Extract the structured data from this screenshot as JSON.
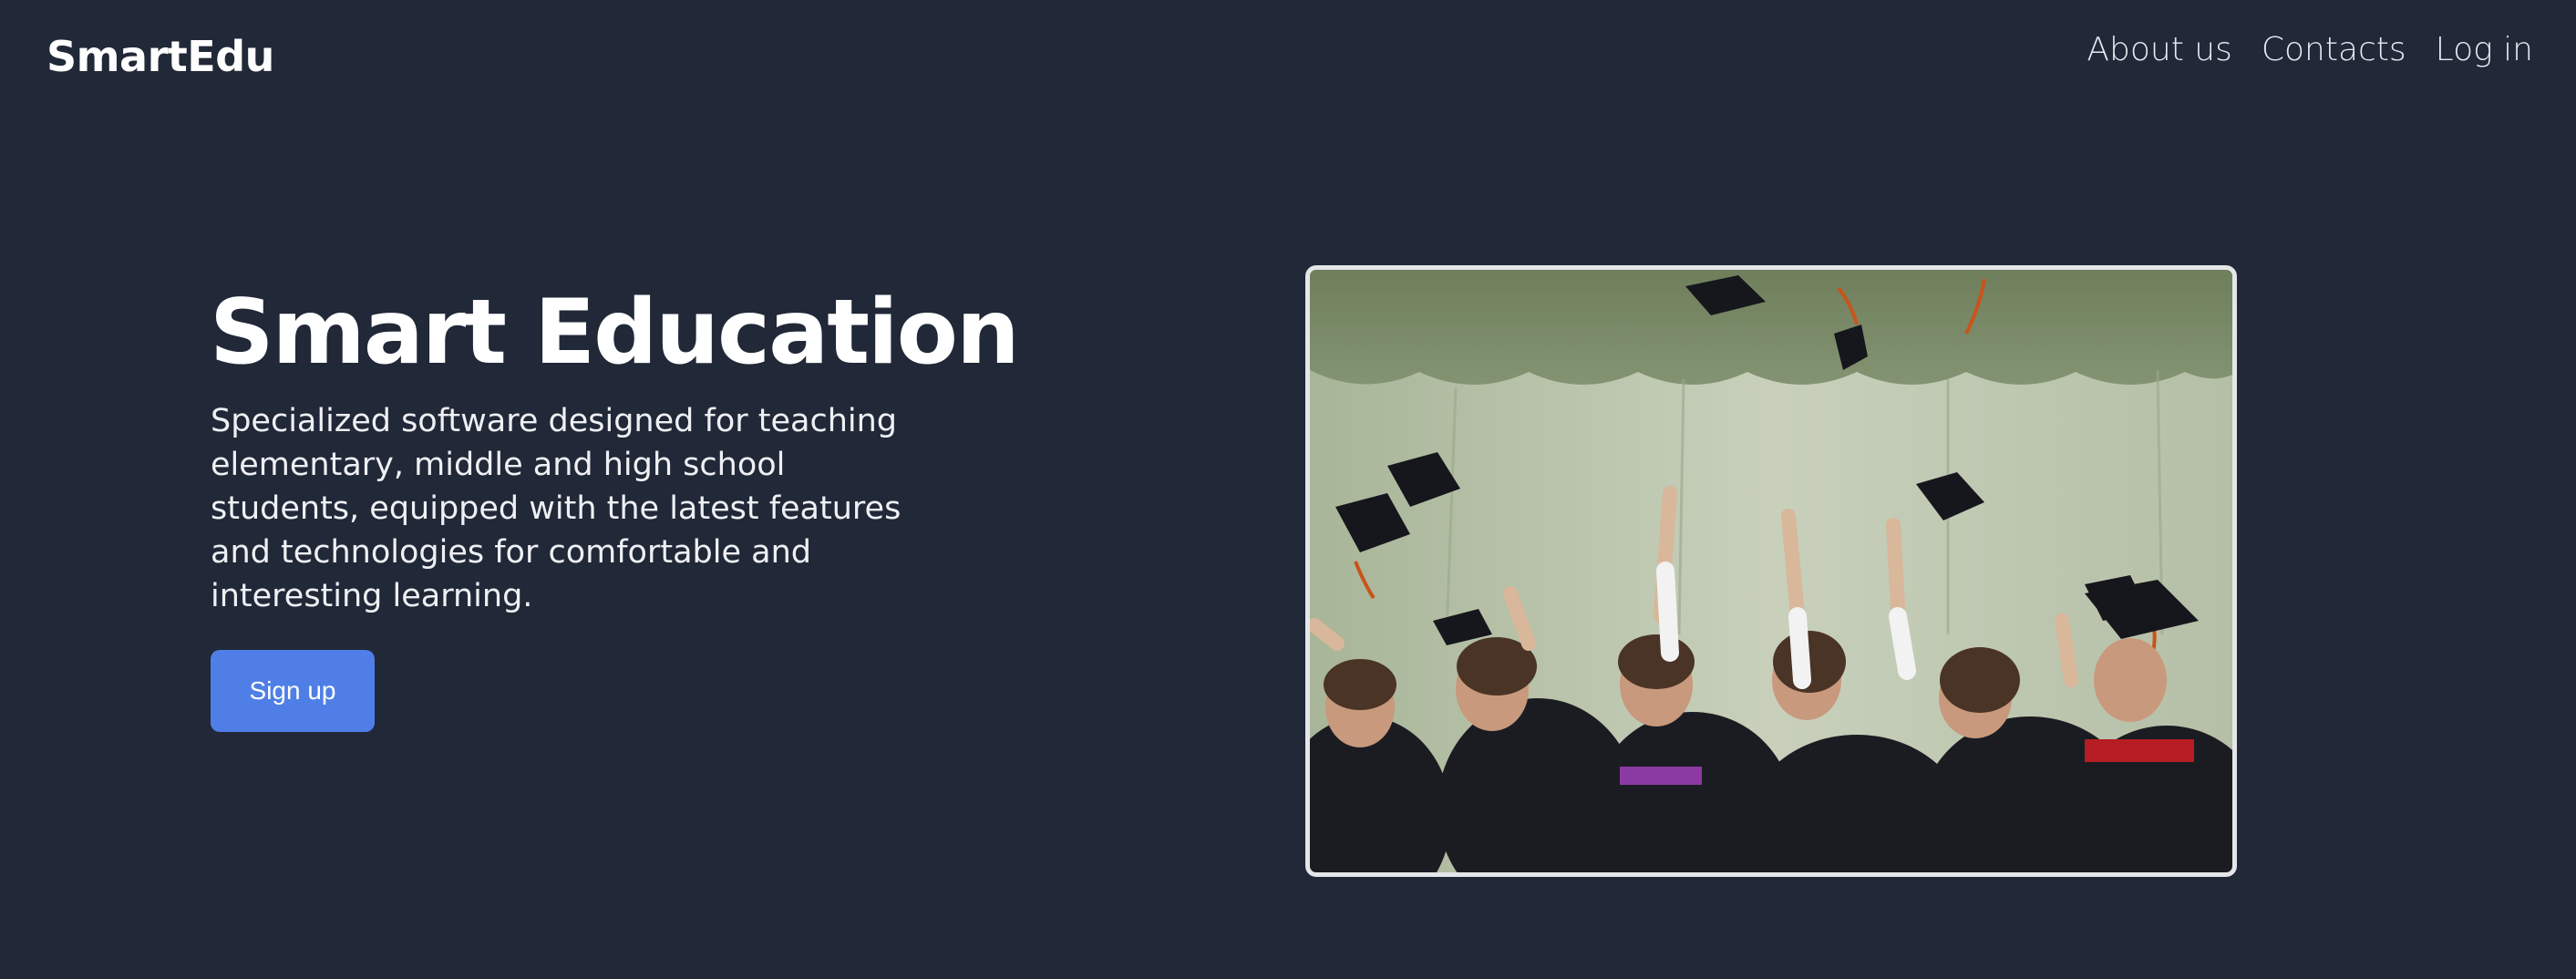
{
  "header": {
    "brand": "SmartEdu",
    "nav": [
      {
        "label": "About us"
      },
      {
        "label": "Contacts"
      },
      {
        "label": "Log in"
      }
    ]
  },
  "hero": {
    "title": "Smart Education",
    "description": "Specialized software designed for teaching elementary, middle and high school students, equipped with the latest features and technologies for comfortable and interesting learning.",
    "signup_label": "Sign up",
    "image": {
      "semantic": "graduation-photo",
      "alt": "Graduates throwing caps in the air"
    }
  },
  "colors": {
    "background": "#212837",
    "accent": "#4f7fe6",
    "text": "#ffffff",
    "image_border": "#e4e6ea"
  }
}
